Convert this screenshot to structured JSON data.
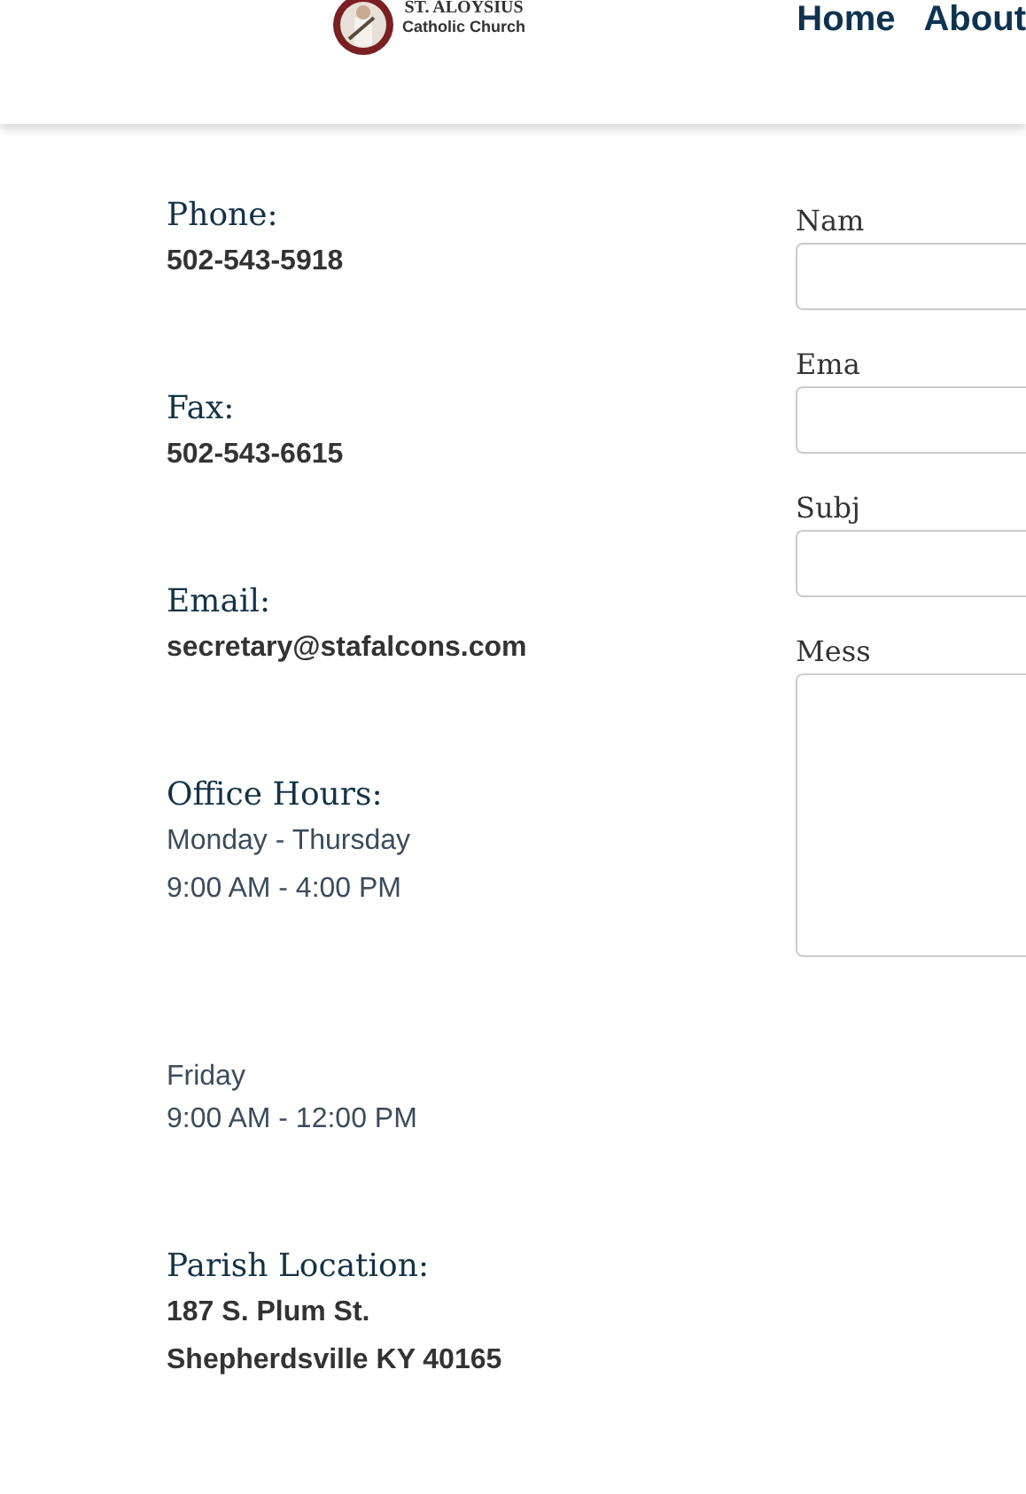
{
  "header": {
    "logo": {
      "title": "ST. ALOYSIUS",
      "subtitle": "Catholic Church"
    },
    "nav": [
      {
        "label": "Home"
      },
      {
        "label": "About"
      }
    ]
  },
  "contact": [
    {
      "heading": "Phone:",
      "kind": "bold",
      "lines": [
        "502-543-5918"
      ]
    },
    {
      "heading": "Fax:",
      "kind": "bold",
      "lines": [
        "502-543-6615"
      ]
    },
    {
      "heading": "Email:",
      "kind": "bold",
      "lines": [
        "secretary@stafalcons.com"
      ]
    },
    {
      "heading": "Office Hours:",
      "kind": "plain",
      "lines": [
        "Monday - Thursday",
        "9:00 AM - 4:00 PM"
      ]
    },
    {
      "kind": "plain",
      "lines": [
        "Friday",
        "9:00 AM - 12:00 PM"
      ]
    },
    {
      "heading": "Parish Location:",
      "kind": "bold",
      "lines": [
        "187 S. Plum St.",
        "Shepherdsville KY 40165"
      ]
    }
  ],
  "form": [
    {
      "label": "Nam",
      "kind": "input"
    },
    {
      "label": "Ema",
      "kind": "input"
    },
    {
      "label": "Subj",
      "kind": "input"
    },
    {
      "label": "Mess",
      "kind": "textarea"
    }
  ]
}
